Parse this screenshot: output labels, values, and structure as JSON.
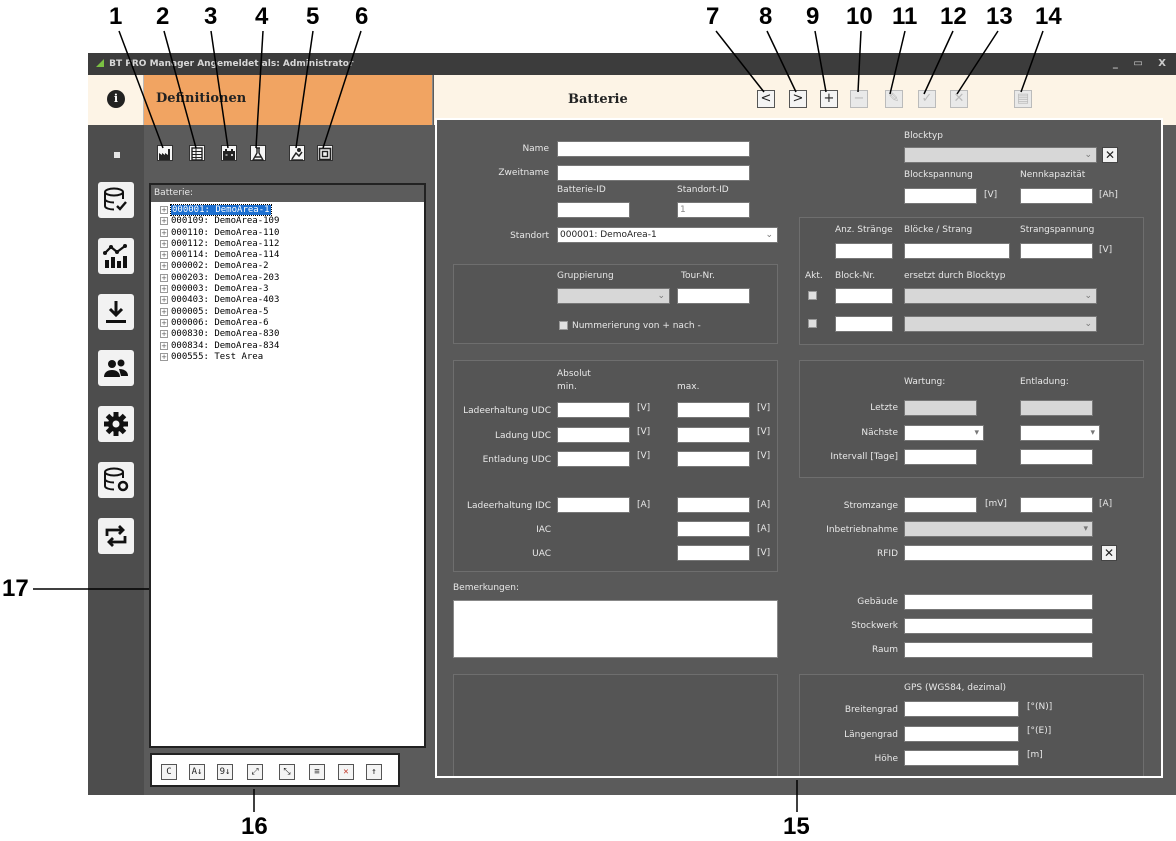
{
  "callouts": {
    "c1": "1",
    "c2": "2",
    "c3": "3",
    "c4": "4",
    "c5": "5",
    "c6": "6",
    "c7": "7",
    "c8": "8",
    "c9": "9",
    "c10": "10",
    "c11": "11",
    "c12": "12",
    "c13": "13",
    "c14": "14",
    "c15": "15",
    "c16": "16",
    "c17": "17"
  },
  "window": {
    "title": "BT PRO Manager   Angemeldet als: Administrator",
    "controls": "_ ▭ X"
  },
  "header": {
    "info_icon": "i",
    "left_title": "Definitionen",
    "main_title": "Batterie"
  },
  "nav": {
    "prev": "<",
    "next": ">",
    "add": "+",
    "remove": "−",
    "edit": "✎",
    "save": "✓",
    "cancel": "✕",
    "extra": "▤"
  },
  "tree": {
    "header": "Batterie:",
    "items": [
      "000001: DemoArea-1",
      "000109: DemoArea-109",
      "000110: DemoArea-110",
      "000112: DemoArea-112",
      "000114: DemoArea-114",
      "000002: DemoArea-2",
      "000203: DemoArea-203",
      "000003: DemoArea-3",
      "000403: DemoArea-403",
      "000005: DemoArea-5",
      "000006: DemoArea-6",
      "000830: DemoArea-830",
      "000834: DemoArea-834",
      "000555: Test Area"
    ]
  },
  "bottom_tools": [
    "C",
    "A↓",
    "9↓",
    "⤢",
    "⤡",
    "≡",
    "✕",
    "↑"
  ],
  "form": {
    "name_label": "Name",
    "zweitname_label": "Zweitname",
    "batterie_id_label": "Batterie-ID",
    "standort_id_label": "Standort-ID",
    "standort_id_value": "1",
    "standort_label": "Standort",
    "standort_value": "000001: DemoArea-1",
    "gruppierung_label": "Gruppierung",
    "tour_label": "Tour-Nr.",
    "nummerierung_label": "Nummerierung von + nach -",
    "blocktyp_label": "Blocktyp",
    "blockspannung_label": "Blockspannung",
    "nennkapazitaet_label": "Nennkapazität",
    "unit_v": "[V]",
    "unit_ah": "[Ah]",
    "unit_a": "[A]",
    "unit_mv": "[mV]",
    "anz_straenge_label": "Anz. Stränge",
    "bloecke_strang_label": "Blöcke / Strang",
    "strangspannung_label": "Strangspannung",
    "akt_label": "Akt.",
    "block_nr_label": "Block-Nr.",
    "ersetzt_label": "ersetzt durch Blocktyp",
    "absolut_label": "Absolut",
    "min_label": "min.",
    "max_label": "max.",
    "ladeerhaltung_udc": "Ladeerhaltung UDC",
    "ladung_udc": "Ladung UDC",
    "entladung_udc": "Entladung UDC",
    "ladeerhaltung_idc": "Ladeerhaltung IDC",
    "iac": "IAC",
    "uac": "UAC",
    "wartung_label": "Wartung:",
    "entladung_label": "Entladung:",
    "letzte_label": "Letzte",
    "naechste_label": "Nächste",
    "intervall_label": "Intervall [Tage]",
    "stromzange_label": "Stromzange",
    "inbetriebnahme_label": "Inbetriebnahme",
    "rfid_label": "RFID",
    "bemerkungen_label": "Bemerkungen:",
    "gebaeude_label": "Gebäude",
    "stockwerk_label": "Stockwerk",
    "raum_label": "Raum",
    "gps_label": "GPS (WGS84, dezimal)",
    "breitengrad_label": "Breitengrad",
    "laengengrad_label": "Längengrad",
    "hoehe_label": "Höhe",
    "unit_n": "[°(N)]",
    "unit_e": "[°(E)]",
    "unit_m": "[m]"
  }
}
